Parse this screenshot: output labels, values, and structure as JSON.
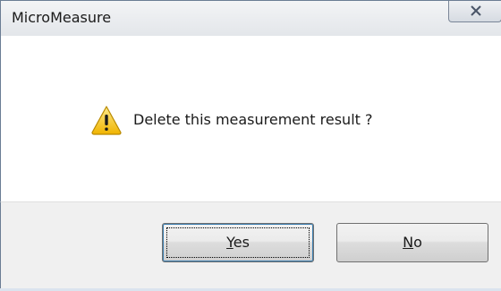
{
  "window": {
    "title": "MicroMeasure"
  },
  "titlebar": {
    "close_icon": "close-icon"
  },
  "message": {
    "icon": "warning-icon",
    "text": "Delete this measurement result ?"
  },
  "buttons": {
    "yes": {
      "mnemonic": "Y",
      "rest": "es"
    },
    "no": {
      "mnemonic": "N",
      "rest": "o"
    }
  },
  "colors": {
    "footer_bg": "#f0f0f0",
    "focus_border": "#3c7fb1",
    "warning_yellow": "#f5c518"
  }
}
